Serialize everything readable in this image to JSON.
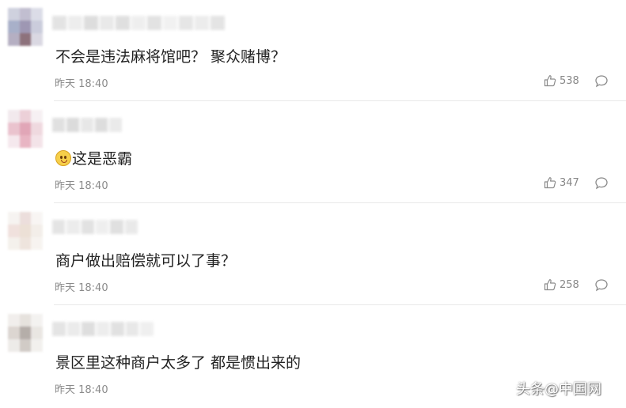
{
  "comments": [
    {
      "text": "不会是违法麻将馆吧？ 聚众赌博？",
      "time": "昨天 18:40",
      "likes": "538",
      "has_emoji": false,
      "avatar_colors": [
        "#c7c9d9",
        "#b7b3c8",
        "#d5d7e3",
        "#9aa3c0",
        "#8e86a6",
        "#c2c4d6",
        "#a9a2b8",
        "#7a5a66",
        "#d4d2de"
      ]
    },
    {
      "text": "这是恶霸",
      "time": "昨天 18:40",
      "likes": "347",
      "has_emoji": true,
      "avatar_colors": [
        "#f0e6ea",
        "#e9c8d2",
        "#f5eef1",
        "#e7b9c6",
        "#dc97ab",
        "#edd3da",
        "#f4e4ea",
        "#e5a9b9",
        "#f2dfe5"
      ]
    },
    {
      "text": "商户做出赔偿就可以了事？",
      "time": "昨天 18:40",
      "likes": "258",
      "has_emoji": false,
      "avatar_colors": [
        "#f5f2ef",
        "#e9d9d6",
        "#f7f4f2",
        "#eedcd8",
        "#e9dbcf",
        "#f1ece6",
        "#f3efe9",
        "#ece0d8",
        "#f6f2ee"
      ]
    },
    {
      "text": "景区里这种商户太多了 都是惯出来的",
      "time": "昨天 18:40",
      "likes": "",
      "has_emoji": false,
      "avatar_colors": [
        "#efece9",
        "#e2ddd8",
        "#f2f0ee",
        "#d6cfca",
        "#a9a09b",
        "#e6e2de",
        "#ebe8e5",
        "#c9c2bd",
        "#f0eeeb"
      ]
    }
  ],
  "watermark": "头条@中国网"
}
